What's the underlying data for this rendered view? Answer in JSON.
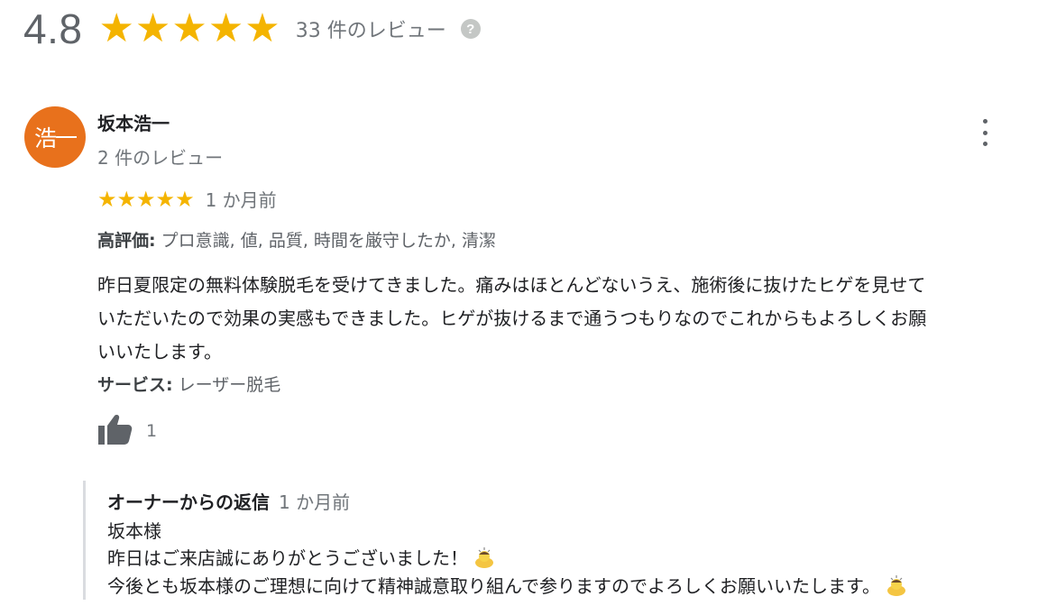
{
  "summary": {
    "rating": "4.8",
    "stars": 5,
    "review_count": "33 件のレビュー",
    "help_icon_glyph": "?"
  },
  "review": {
    "avatar_text": "浩一",
    "avatar_color": "#e8711c",
    "reviewer_name": "坂本浩一",
    "reviewer_reviews": "2 件のレビュー",
    "stars": 5,
    "time": "1 か月前",
    "highlights_label": "高評価:",
    "highlights_text": "プロ意識, 値, 品質, 時間を厳守したか, 清潔",
    "body_lines": [
      "昨日夏限定の無料体験脱毛を受けてきました。痛みはほとんどないうえ、施術後に抜けたヒゲを見せて",
      "いただいたので効果の実感もできました。ヒゲが抜けるまで通うつもりなのでこれからもよろしくお願",
      "いいたします。"
    ],
    "service_label": "サービス:",
    "service_text": "レーザー脱毛",
    "like_count": "1"
  },
  "owner_reply": {
    "title": "オーナーからの返信",
    "time": "1 か月前",
    "lines": [
      "坂本様",
      "昨日はご来店誠にありがとうございました！",
      "今後とも坂本様のご理想に向けて精神誠意取り組んで参りますのでよろしくお願いいたします。"
    ]
  },
  "colors": {
    "star": "#f4b400",
    "avatar": "#e8711c",
    "secondary_text": "#70757a"
  },
  "icons": [
    "help-icon",
    "more-vert-icon",
    "thumbs-up-icon",
    "bowing-person-emoji"
  ]
}
